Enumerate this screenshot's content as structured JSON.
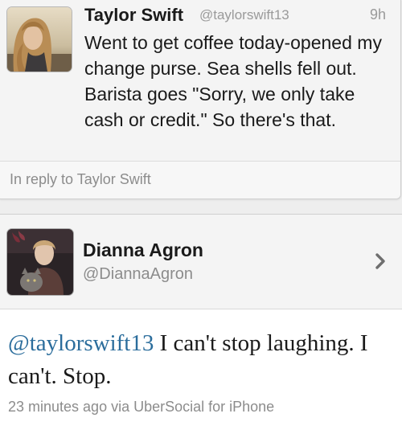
{
  "reply_tweet": {
    "author_name": "Taylor Swift",
    "author_handle": "@taylorswift13",
    "time": "9h",
    "text": "Went to get coffee today-opened my change purse. Sea shells fell out. Barista goes \"Sorry, we only take cash or credit.\" So there's that.",
    "in_reply_label": "In reply to Taylor Swift"
  },
  "main_tweet": {
    "author_name": "Dianna Agron",
    "author_handle": "@DiannaAgron",
    "mention": "@taylorswift13",
    "text": " I can't stop laughing. I can't. Stop.",
    "meta": "23 minutes ago via UberSocial for iPhone"
  },
  "colors": {
    "mention": "#2b6d9c",
    "muted_text": "#8c8c8c"
  },
  "icons": {
    "profile_chevron": "chevron-right-icon"
  }
}
